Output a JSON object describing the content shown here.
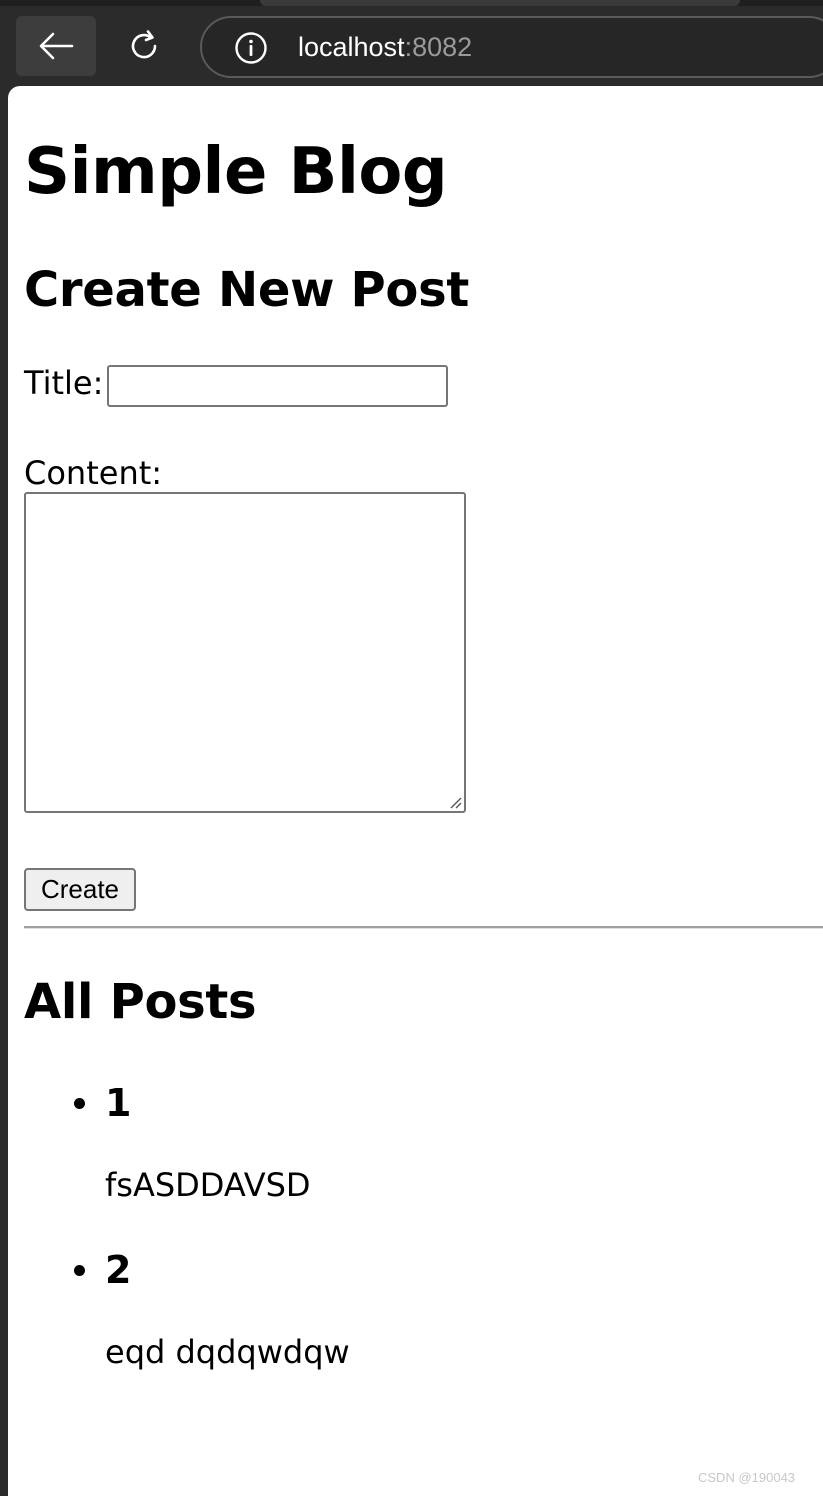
{
  "browser": {
    "url_host": "localhost",
    "url_port": ":8082",
    "back_icon": "arrow-left-icon",
    "reload_icon": "reload-icon",
    "info_icon": "info-icon"
  },
  "page": {
    "title": "Simple Blog",
    "create_section": {
      "heading": "Create New Post",
      "title_label": "Title:",
      "title_value": "",
      "content_label": "Content:",
      "content_value": "",
      "submit_label": "Create"
    },
    "posts_section": {
      "heading": "All Posts",
      "posts": [
        {
          "title": "1",
          "content": "fsASDDAVSD"
        },
        {
          "title": "2",
          "content": "eqd dqdqwdqw"
        }
      ]
    }
  },
  "watermark": "CSDN @190043"
}
